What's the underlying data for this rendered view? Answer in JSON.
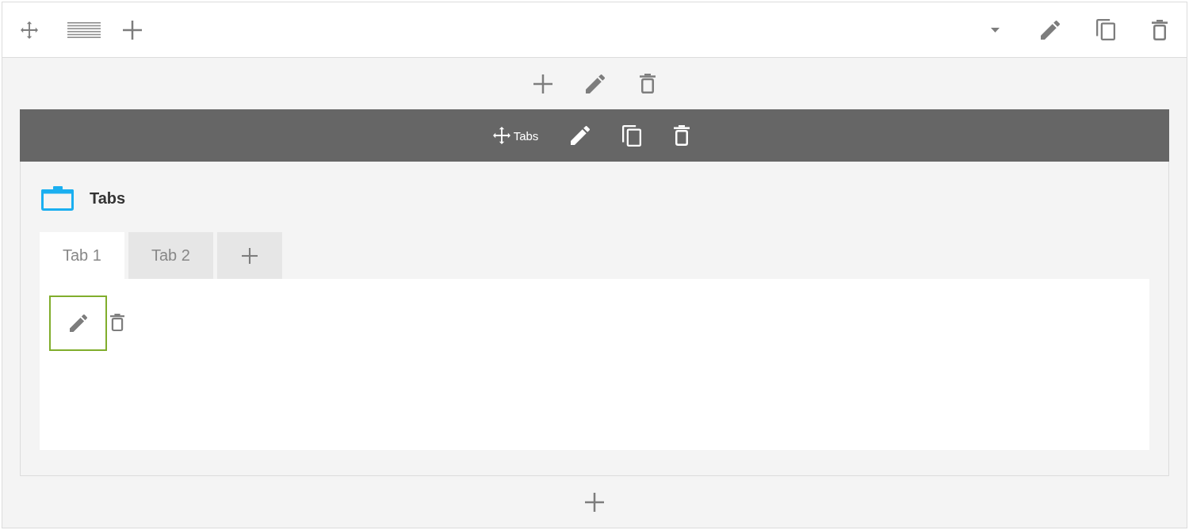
{
  "module_bar": {
    "label": "Tabs"
  },
  "module": {
    "title": "Tabs",
    "tabs": [
      {
        "label": "Tab 1",
        "selected": true
      },
      {
        "label": "Tab 2",
        "selected": false
      }
    ]
  }
}
